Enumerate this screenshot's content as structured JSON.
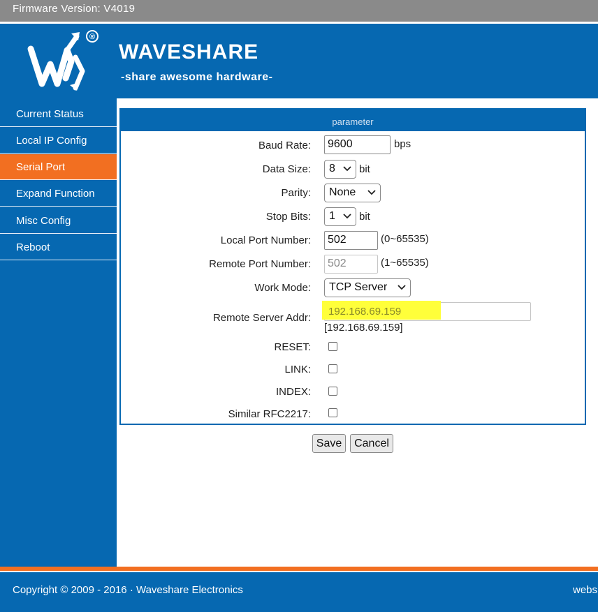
{
  "firmware": "Firmware Version:  V4019",
  "brand": {
    "name": "WAVESHARE",
    "tagline": "-share awesome hardware-",
    "registered": "®"
  },
  "sidebar": {
    "items": [
      {
        "label": "Current Status"
      },
      {
        "label": "Local IP Config"
      },
      {
        "label": "Serial Port",
        "active": true
      },
      {
        "label": "Expand Function"
      },
      {
        "label": "Misc Config"
      },
      {
        "label": "Reboot"
      }
    ]
  },
  "panel": {
    "title": "parameter",
    "baud_rate": {
      "label": "Baud Rate:",
      "value": "9600",
      "unit": "bps"
    },
    "data_size": {
      "label": "Data Size:",
      "value": "8",
      "unit": "bit"
    },
    "parity": {
      "label": "Parity:",
      "value": "None"
    },
    "stop_bits": {
      "label": "Stop Bits:",
      "value": "1",
      "unit": "bit"
    },
    "local_port": {
      "label": "Local Port Number:",
      "value": "502",
      "range": "(0~65535)"
    },
    "remote_port": {
      "label": "Remote Port Number:",
      "value": "502",
      "range": "(1~65535)"
    },
    "work_mode": {
      "label": "Work Mode:",
      "value": "TCP Server"
    },
    "remote_addr": {
      "label": "Remote Server Addr:",
      "value": "192.168.69.159",
      "resolved": "[192.168.69.159]"
    },
    "reset": {
      "label": "RESET:",
      "checked": false
    },
    "link": {
      "label": "LINK:",
      "checked": false
    },
    "index": {
      "label": "INDEX:",
      "checked": false
    },
    "rfc2217": {
      "label": "Similar RFC2217:",
      "checked": false
    }
  },
  "actions": {
    "save": "Save",
    "cancel": "Cancel"
  },
  "footer": {
    "copyright": "Copyright © 2009 - 2016 · Waveshare Electronics",
    "website": "webs"
  },
  "colors": {
    "brand_blue": "#0668b1",
    "active_orange": "#f26f21",
    "highlight_yellow": "#ffff3a"
  }
}
